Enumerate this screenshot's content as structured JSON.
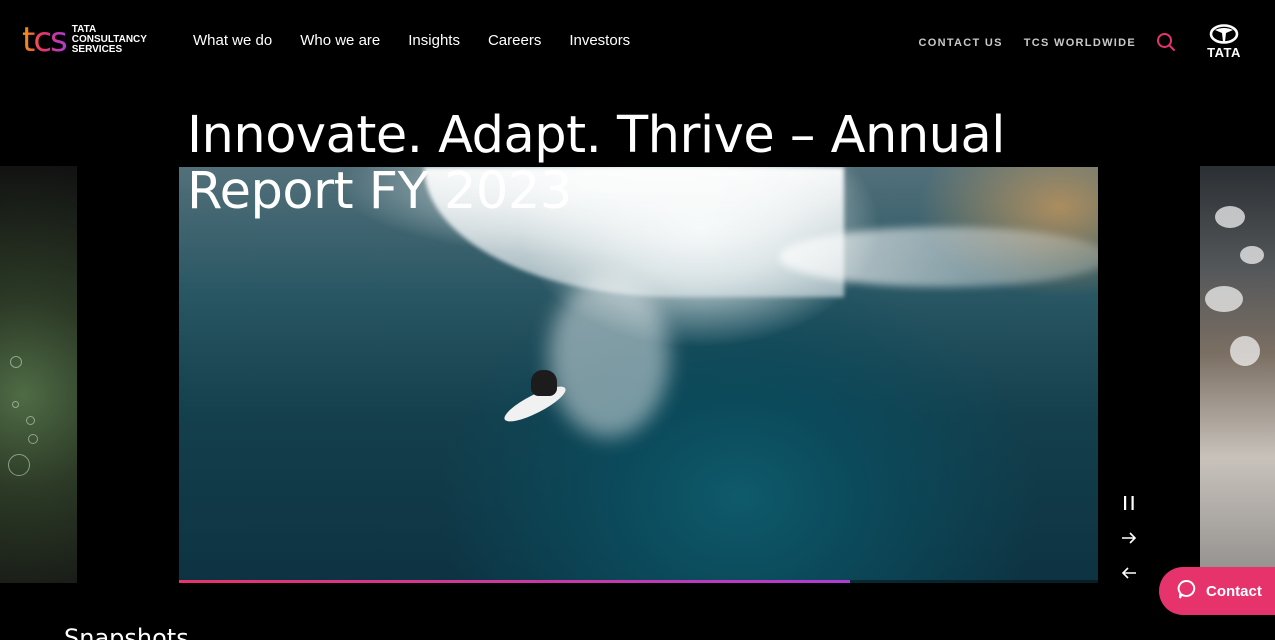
{
  "brand": {
    "logo_mark": "tcs",
    "logo_lines": [
      "TATA",
      "CONSULTANCY",
      "SERVICES"
    ],
    "group_logo": "TATA"
  },
  "nav": {
    "items": [
      "What we do",
      "Who we are",
      "Insights",
      "Careers",
      "Investors"
    ]
  },
  "utility": {
    "contact_us": "CONTACT US",
    "worldwide": "TCS WORLDWIDE",
    "search_icon": "search-icon"
  },
  "hero": {
    "headline": "Innovate. Adapt. Thrive – Annual Report FY 2023",
    "progress_fraction": 0.73,
    "controls": [
      "pause-icon",
      "arrow-right-icon",
      "arrow-left-icon"
    ]
  },
  "contact_button": {
    "label": "Contact",
    "icon": "chat-icon"
  },
  "next_section": {
    "title": "Snapshots"
  },
  "colors": {
    "accent": "#e6336b",
    "accent_purple": "#b13bd6",
    "background": "#000000"
  }
}
